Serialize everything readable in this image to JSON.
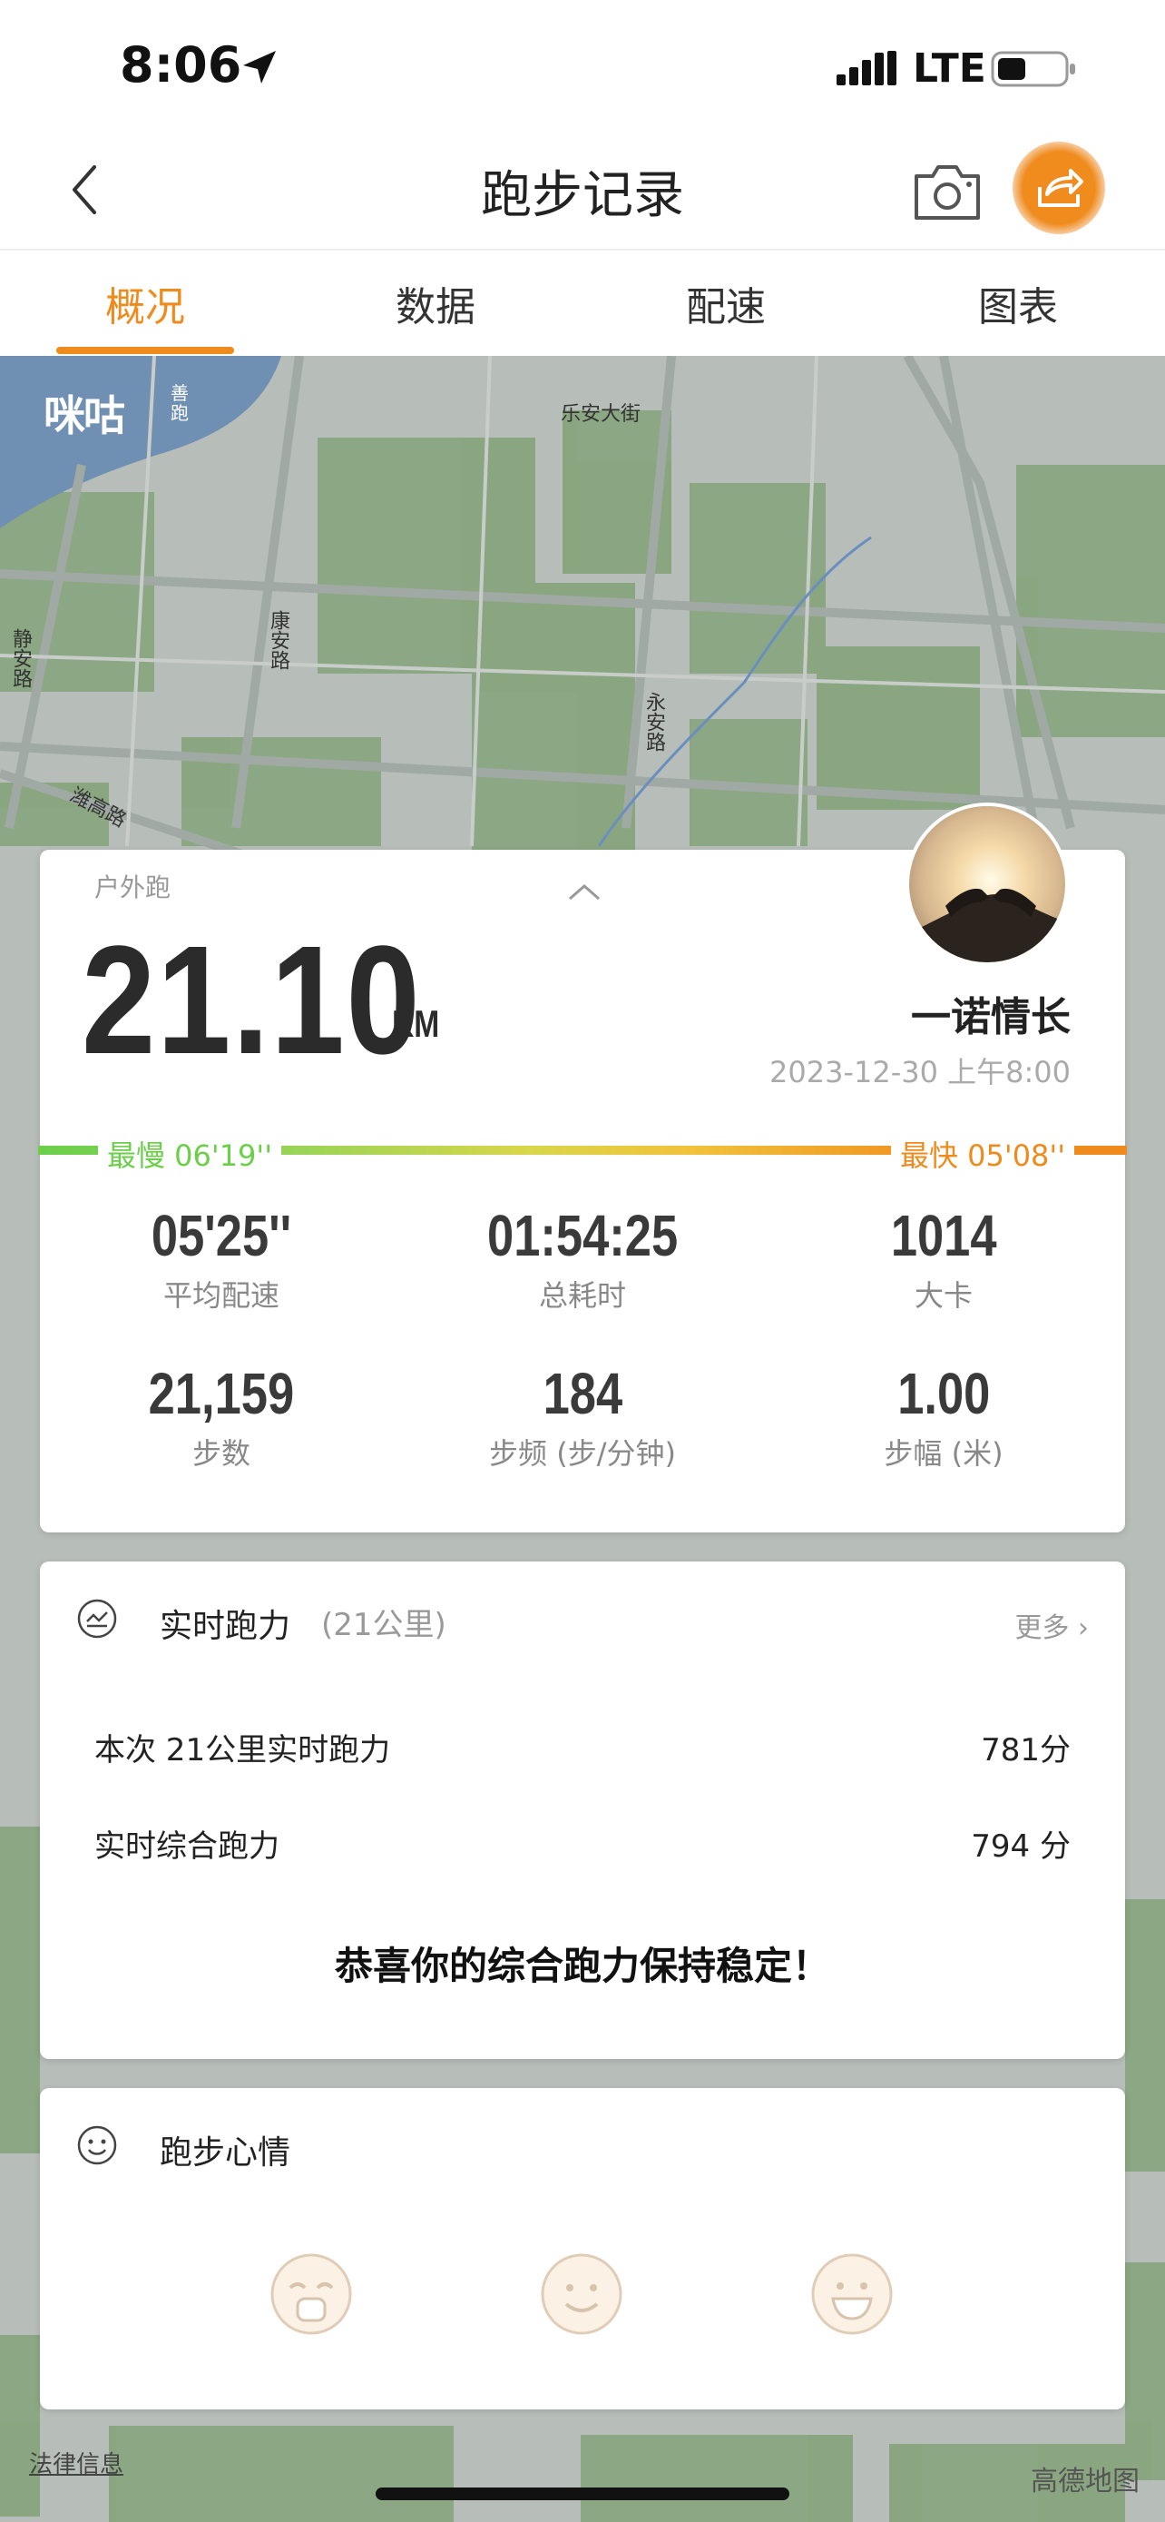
{
  "status": {
    "time": "8:06",
    "network": "LTE"
  },
  "nav": {
    "title": "跑步记录"
  },
  "tabs": [
    {
      "label": "概况",
      "active": true
    },
    {
      "label": "数据",
      "active": false
    },
    {
      "label": "配速",
      "active": false
    },
    {
      "label": "图表",
      "active": false
    }
  ],
  "map": {
    "logo": "咪咕",
    "logo_small": "善跑",
    "roads": [
      "乐安大街",
      "静安路",
      "康安路",
      "永安路",
      "潍高路"
    ],
    "legal": "法律信息",
    "provider": "高德地图"
  },
  "summary": {
    "run_type": "户外跑",
    "distance": "21.10",
    "unit": "KM",
    "username": "一诺情长",
    "datetime": "2023-12-30 上午8:00",
    "slowest": "最慢  06'19''",
    "fastest": "最快  05'08''",
    "stats": [
      {
        "value": "05'25''",
        "label": "平均配速"
      },
      {
        "value": "01:54:25",
        "label": "总耗时"
      },
      {
        "value": "1014",
        "label": "大卡"
      },
      {
        "value": "21,159",
        "label": "步数"
      },
      {
        "value": "184",
        "label": "步频 (步/分钟)"
      },
      {
        "value": "1.00",
        "label": "步幅 (米)"
      }
    ]
  },
  "power": {
    "title": "实时跑力",
    "subtitle": "(21公里)",
    "more": "更多 ›",
    "rows": [
      {
        "label": "本次 21公里实时跑力",
        "value": "781分"
      },
      {
        "label": "实时综合跑力",
        "value": "794 分"
      }
    ],
    "message": "恭喜你的综合跑力保持稳定！"
  },
  "mood": {
    "title": "跑步心情"
  },
  "colors": {
    "accent": "#ef8a1c",
    "slow": "#6bcf4a",
    "map_green": "#8aa882",
    "map_grey": "#b9c0bb"
  }
}
